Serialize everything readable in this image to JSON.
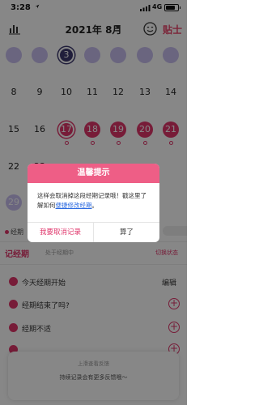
{
  "status_bar": {
    "time": "3:28",
    "network": "4G"
  },
  "header": {
    "month": "2021年 8月",
    "tips": "贴士",
    "icons": [
      "chart-icon",
      "dropdown-icon",
      "face-icon"
    ]
  },
  "calendar": {
    "weeks": [
      [
        {
          "d": "",
          "t": "predict"
        },
        {
          "d": "",
          "t": "predict"
        },
        {
          "d": "3",
          "t": "today"
        },
        {
          "d": "",
          "t": "predict"
        },
        {
          "d": "",
          "t": "predict"
        },
        {
          "d": "",
          "t": "predict"
        },
        {
          "d": "",
          "t": "predict"
        }
      ],
      [
        {
          "d": "8",
          "t": ""
        },
        {
          "d": "9",
          "t": ""
        },
        {
          "d": "10",
          "t": ""
        },
        {
          "d": "11",
          "t": ""
        },
        {
          "d": "12",
          "t": ""
        },
        {
          "d": "13",
          "t": ""
        },
        {
          "d": "14",
          "t": ""
        }
      ],
      [
        {
          "d": "15",
          "t": ""
        },
        {
          "d": "16",
          "t": ""
        },
        {
          "d": "17",
          "t": "period-outline"
        },
        {
          "d": "18",
          "t": "period"
        },
        {
          "d": "19",
          "t": "period"
        },
        {
          "d": "20",
          "t": "period"
        },
        {
          "d": "21",
          "t": "period"
        }
      ],
      [
        {
          "d": "22",
          "t": ""
        },
        {
          "d": "23",
          "t": ""
        },
        {
          "d": "",
          "t": ""
        },
        {
          "d": "",
          "t": ""
        },
        {
          "d": "",
          "t": ""
        },
        {
          "d": "",
          "t": ""
        },
        {
          "d": "",
          "t": ""
        }
      ],
      [
        {
          "d": "29",
          "t": "predict"
        },
        {
          "d": "",
          "t": ""
        },
        {
          "d": "",
          "t": ""
        },
        {
          "d": "",
          "t": ""
        },
        {
          "d": "",
          "t": ""
        },
        {
          "d": "",
          "t": ""
        },
        {
          "d": "",
          "t": ""
        }
      ]
    ],
    "colors": {
      "predict": "#c9bff0",
      "period": "#e0366b",
      "today": "#3e3970"
    }
  },
  "legend": {
    "label": "经期"
  },
  "record": {
    "title": "记经期",
    "subtitle": "处于经期中",
    "switch": "切换状态",
    "rows": [
      {
        "label": "今天经期开始",
        "action": "编辑"
      },
      {
        "label": "经期结束了吗?",
        "action": "+"
      },
      {
        "label": "经期不适",
        "action": "+"
      },
      {
        "label": "",
        "action": "+"
      }
    ]
  },
  "feedback": {
    "up": "上滑查看反馈",
    "message": "持续记录会有更多反馈哦～"
  },
  "dialog": {
    "title": "温馨提示",
    "body_pre": "这样会取消掉这段经期记录哦！戳这里了解如何",
    "body_link": "便捷修改经期",
    "body_post": "。",
    "cancel_label": "我要取消记录",
    "ok_label": "算了"
  },
  "accent_color": "#e0366b",
  "dialog_header_color": "#ee5e86"
}
